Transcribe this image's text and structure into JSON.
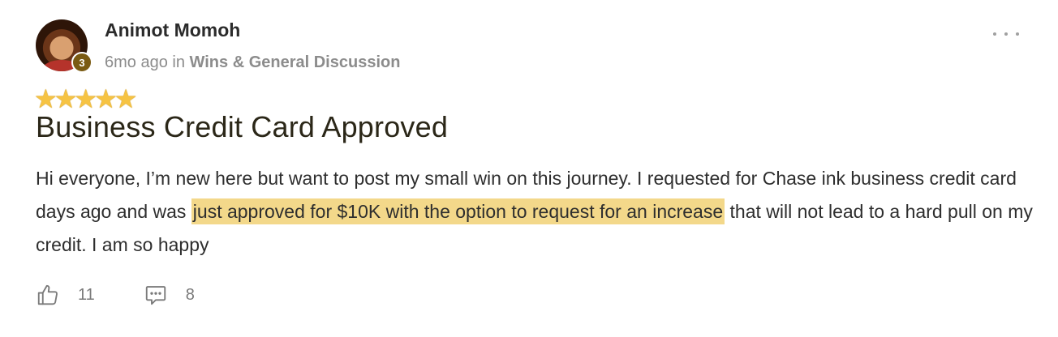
{
  "post": {
    "author": "Animot Momoh",
    "level": "3",
    "time_ago": "6mo ago",
    "in_word": "in",
    "category": "Wins & General Discussion",
    "rating_stars": "★★★★★",
    "rating": 5,
    "title": "Business Credit Card Approved",
    "body_before": "Hi everyone, I’m new here but want to post my small win on this journey. I requested for Chase ink business credit card days ago and was ",
    "body_highlight": "just approved for $10K with the option to request for an increase",
    "body_after": " that will not lead to a hard pull on my credit. I am so happy",
    "likes": "11",
    "comments": "8"
  },
  "icons": {
    "like": "thumbs-up-icon",
    "comment": "comment-icon",
    "more": "more-options-icon"
  },
  "colors": {
    "highlight": "#f3d88a",
    "star": "#f6c343",
    "badge": "#7a5a12"
  }
}
